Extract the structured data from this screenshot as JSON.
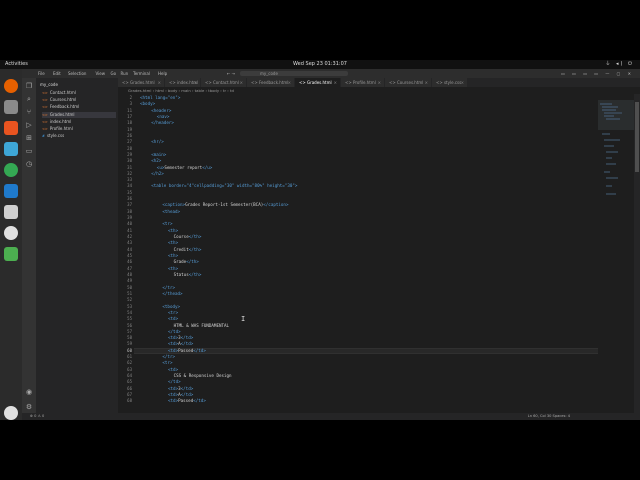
{
  "top_bar": {
    "activities": "Activities",
    "clock": "Wed Sep 23  01:31:07",
    "system_icons": "⏚ ◂) ⏻"
  },
  "dock": {
    "apps": [
      {
        "icon": "firefox-icon",
        "color": "#e66000"
      },
      {
        "icon": "files-icon",
        "color": "#8a8a8a"
      },
      {
        "icon": "software-center-icon",
        "color": "#e95420"
      },
      {
        "icon": "help-icon",
        "color": "#3ea6d6"
      },
      {
        "icon": "chrome-icon",
        "color": "#34a853"
      },
      {
        "icon": "vscode-icon",
        "color": "#1f7acc"
      },
      {
        "icon": "text-editor-icon",
        "color": "#d0d0d0"
      },
      {
        "icon": "github-icon",
        "color": "#e0e0e0"
      },
      {
        "icon": "recycle-bin-icon",
        "color": "#4caf50"
      },
      {
        "icon": "show-apps-icon",
        "color": "#e0e0e0"
      }
    ]
  },
  "window": {
    "menu": [
      "File",
      "Edit",
      "Selection",
      "View",
      "Go",
      "Run",
      "Terminal",
      "Help"
    ],
    "search": "my_code",
    "nav_arrows": "←  →",
    "controls": "▭ ▭ ▭ ▭  —  ▢  ✕"
  },
  "explorer": {
    "header": "my_code",
    "files": [
      {
        "name": "Contact.html",
        "type": "html"
      },
      {
        "name": "Courses.html",
        "type": "html"
      },
      {
        "name": "Feedback.html",
        "type": "html"
      },
      {
        "name": "Grades.html",
        "type": "html",
        "active": true
      },
      {
        "name": "index.html",
        "type": "html"
      },
      {
        "name": "Profile.html",
        "type": "html"
      },
      {
        "name": "style.css",
        "type": "css"
      }
    ]
  },
  "tabs": [
    {
      "label": "Grades.html",
      "active": false
    },
    {
      "label": "index.html",
      "active": false
    },
    {
      "label": "Contact.html",
      "active": false
    },
    {
      "label": "Feedback.html",
      "active": false
    },
    {
      "label": "Grades.html",
      "active": true
    },
    {
      "label": "Profile.html",
      "active": false
    },
    {
      "label": "Courses.html",
      "active": false
    },
    {
      "label": "style.css",
      "active": false
    }
  ],
  "breadcrumb": "Grades.html › html › body › main › table › tbody › tr › td",
  "editor": {
    "lines": [
      {
        "n": "2",
        "indent": 0,
        "parts": [
          {
            "t": "tag",
            "v": "<html lang=\"en\">"
          }
        ]
      },
      {
        "n": "3",
        "indent": 0,
        "parts": [
          {
            "t": "tag",
            "v": "<body>"
          }
        ]
      },
      {
        "n": "11",
        "indent": 2,
        "parts": [
          {
            "t": "tag",
            "v": "<header>"
          }
        ]
      },
      {
        "n": "17",
        "indent": 3,
        "parts": [
          {
            "t": "tag",
            "v": "<nav>"
          }
        ]
      },
      {
        "n": "18",
        "indent": 2,
        "parts": [
          {
            "t": "tag",
            "v": "</header>"
          }
        ]
      },
      {
        "n": "19",
        "indent": 0,
        "parts": []
      },
      {
        "n": "26",
        "indent": 0,
        "parts": []
      },
      {
        "n": "27",
        "indent": 2,
        "parts": [
          {
            "t": "tag",
            "v": "<hr/>"
          }
        ]
      },
      {
        "n": "28",
        "indent": 0,
        "parts": []
      },
      {
        "n": "29",
        "indent": 2,
        "parts": [
          {
            "t": "tag",
            "v": "<main>"
          }
        ]
      },
      {
        "n": "30",
        "indent": 2,
        "parts": [
          {
            "t": "tag",
            "v": "<h2>"
          }
        ]
      },
      {
        "n": "31",
        "indent": 3,
        "parts": [
          {
            "t": "tag",
            "v": "<u>"
          },
          {
            "t": "text",
            "v": "Semester report"
          },
          {
            "t": "tag",
            "v": "</u>"
          }
        ]
      },
      {
        "n": "32",
        "indent": 2,
        "parts": [
          {
            "t": "tag",
            "v": "</h2>"
          }
        ]
      },
      {
        "n": "33",
        "indent": 0,
        "parts": []
      },
      {
        "n": "34",
        "indent": 2,
        "parts": [
          {
            "t": "tag",
            "v": "<table border=\"4\"cellpadding=\"30\" width=\"80%\" height=\"30\">"
          }
        ]
      },
      {
        "n": "35",
        "indent": 0,
        "parts": []
      },
      {
        "n": "36",
        "indent": 0,
        "parts": []
      },
      {
        "n": "37",
        "indent": 4,
        "parts": [
          {
            "t": "tag",
            "v": "<caption>"
          },
          {
            "t": "text",
            "v": "Grades Report-1st Semester(BCA)"
          },
          {
            "t": "tag",
            "v": "</caption>"
          }
        ]
      },
      {
        "n": "38",
        "indent": 4,
        "parts": [
          {
            "t": "tag",
            "v": "<thead>"
          }
        ]
      },
      {
        "n": "39",
        "indent": 0,
        "parts": []
      },
      {
        "n": "40",
        "indent": 4,
        "parts": [
          {
            "t": "tag",
            "v": "<tr>"
          }
        ]
      },
      {
        "n": "41",
        "indent": 5,
        "parts": [
          {
            "t": "tag",
            "v": "<th>"
          }
        ]
      },
      {
        "n": "42",
        "indent": 6,
        "parts": [
          {
            "t": "text",
            "v": "Course"
          },
          {
            "t": "tag",
            "v": "</th>"
          }
        ]
      },
      {
        "n": "43",
        "indent": 5,
        "parts": [
          {
            "t": "tag",
            "v": "<th>"
          }
        ]
      },
      {
        "n": "44",
        "indent": 6,
        "parts": [
          {
            "t": "text",
            "v": "Credit"
          },
          {
            "t": "tag",
            "v": "</th>"
          }
        ]
      },
      {
        "n": "45",
        "indent": 5,
        "parts": [
          {
            "t": "tag",
            "v": "<th>"
          }
        ]
      },
      {
        "n": "46",
        "indent": 6,
        "parts": [
          {
            "t": "text",
            "v": "Grade"
          },
          {
            "t": "tag",
            "v": "</th>"
          }
        ]
      },
      {
        "n": "47",
        "indent": 5,
        "parts": [
          {
            "t": "tag",
            "v": "<th>"
          }
        ]
      },
      {
        "n": "48",
        "indent": 6,
        "parts": [
          {
            "t": "text",
            "v": "Status"
          },
          {
            "t": "tag",
            "v": "</th>"
          }
        ]
      },
      {
        "n": "49",
        "indent": 0,
        "parts": []
      },
      {
        "n": "50",
        "indent": 4,
        "parts": [
          {
            "t": "tag",
            "v": "</tr>"
          }
        ]
      },
      {
        "n": "51",
        "indent": 4,
        "parts": [
          {
            "t": "tag",
            "v": "</thead>"
          }
        ]
      },
      {
        "n": "52",
        "indent": 0,
        "parts": []
      },
      {
        "n": "53",
        "indent": 4,
        "parts": [
          {
            "t": "tag",
            "v": "<tbody>"
          }
        ]
      },
      {
        "n": "54",
        "indent": 5,
        "parts": [
          {
            "t": "tag",
            "v": "<tr>"
          }
        ]
      },
      {
        "n": "55",
        "indent": 5,
        "parts": [
          {
            "t": "tag",
            "v": "<td>"
          }
        ]
      },
      {
        "n": "56",
        "indent": 6,
        "parts": [
          {
            "t": "text",
            "v": "HTML & WAS FUNDAMENTAL"
          }
        ]
      },
      {
        "n": "57",
        "indent": 5,
        "parts": [
          {
            "t": "tag",
            "v": "</td>"
          }
        ]
      },
      {
        "n": "58",
        "indent": 5,
        "parts": [
          {
            "t": "tag",
            "v": "<td>"
          },
          {
            "t": "text",
            "v": "3"
          },
          {
            "t": "tag",
            "v": "</td>"
          }
        ]
      },
      {
        "n": "59",
        "indent": 5,
        "parts": [
          {
            "t": "tag",
            "v": "<td>"
          },
          {
            "t": "text",
            "v": "A"
          },
          {
            "t": "tag",
            "v": "</td>"
          }
        ]
      },
      {
        "n": "60",
        "indent": 5,
        "parts": [
          {
            "t": "tag",
            "v": "<td>"
          },
          {
            "t": "text",
            "v": "Passed"
          },
          {
            "t": "tag",
            "v": "</td>"
          }
        ],
        "current": true
      },
      {
        "n": "61",
        "indent": 4,
        "parts": [
          {
            "t": "tag",
            "v": "</tr>"
          }
        ]
      },
      {
        "n": "62",
        "indent": 4,
        "parts": [
          {
            "t": "tag",
            "v": "<tr>"
          }
        ]
      },
      {
        "n": "63",
        "indent": 5,
        "parts": [
          {
            "t": "tag",
            "v": "<td>"
          }
        ]
      },
      {
        "n": "64",
        "indent": 6,
        "parts": [
          {
            "t": "text",
            "v": "CSS & Responsive Design"
          }
        ]
      },
      {
        "n": "65",
        "indent": 5,
        "parts": [
          {
            "t": "tag",
            "v": "</td>"
          }
        ]
      },
      {
        "n": "66",
        "indent": 5,
        "parts": [
          {
            "t": "tag",
            "v": "<td>"
          },
          {
            "t": "text",
            "v": "3"
          },
          {
            "t": "tag",
            "v": "</td>"
          }
        ]
      },
      {
        "n": "67",
        "indent": 5,
        "parts": [
          {
            "t": "tag",
            "v": "<td>"
          },
          {
            "t": "text",
            "v": "A"
          },
          {
            "t": "tag",
            "v": "</td>"
          }
        ]
      },
      {
        "n": "68",
        "indent": 5,
        "parts": [
          {
            "t": "tag",
            "v": "<td>"
          },
          {
            "t": "text",
            "v": "Passed"
          },
          {
            "t": "tag",
            "v": "</td>"
          }
        ]
      }
    ]
  },
  "status_bar": {
    "left": "⊗ 0 ⚠ 0",
    "right": "Ln 60, Col 30   Spaces: 4"
  },
  "colors": {
    "tag": "#569cd6",
    "text": "#d4d4d4",
    "editor_bg": "#1e1e1e"
  }
}
